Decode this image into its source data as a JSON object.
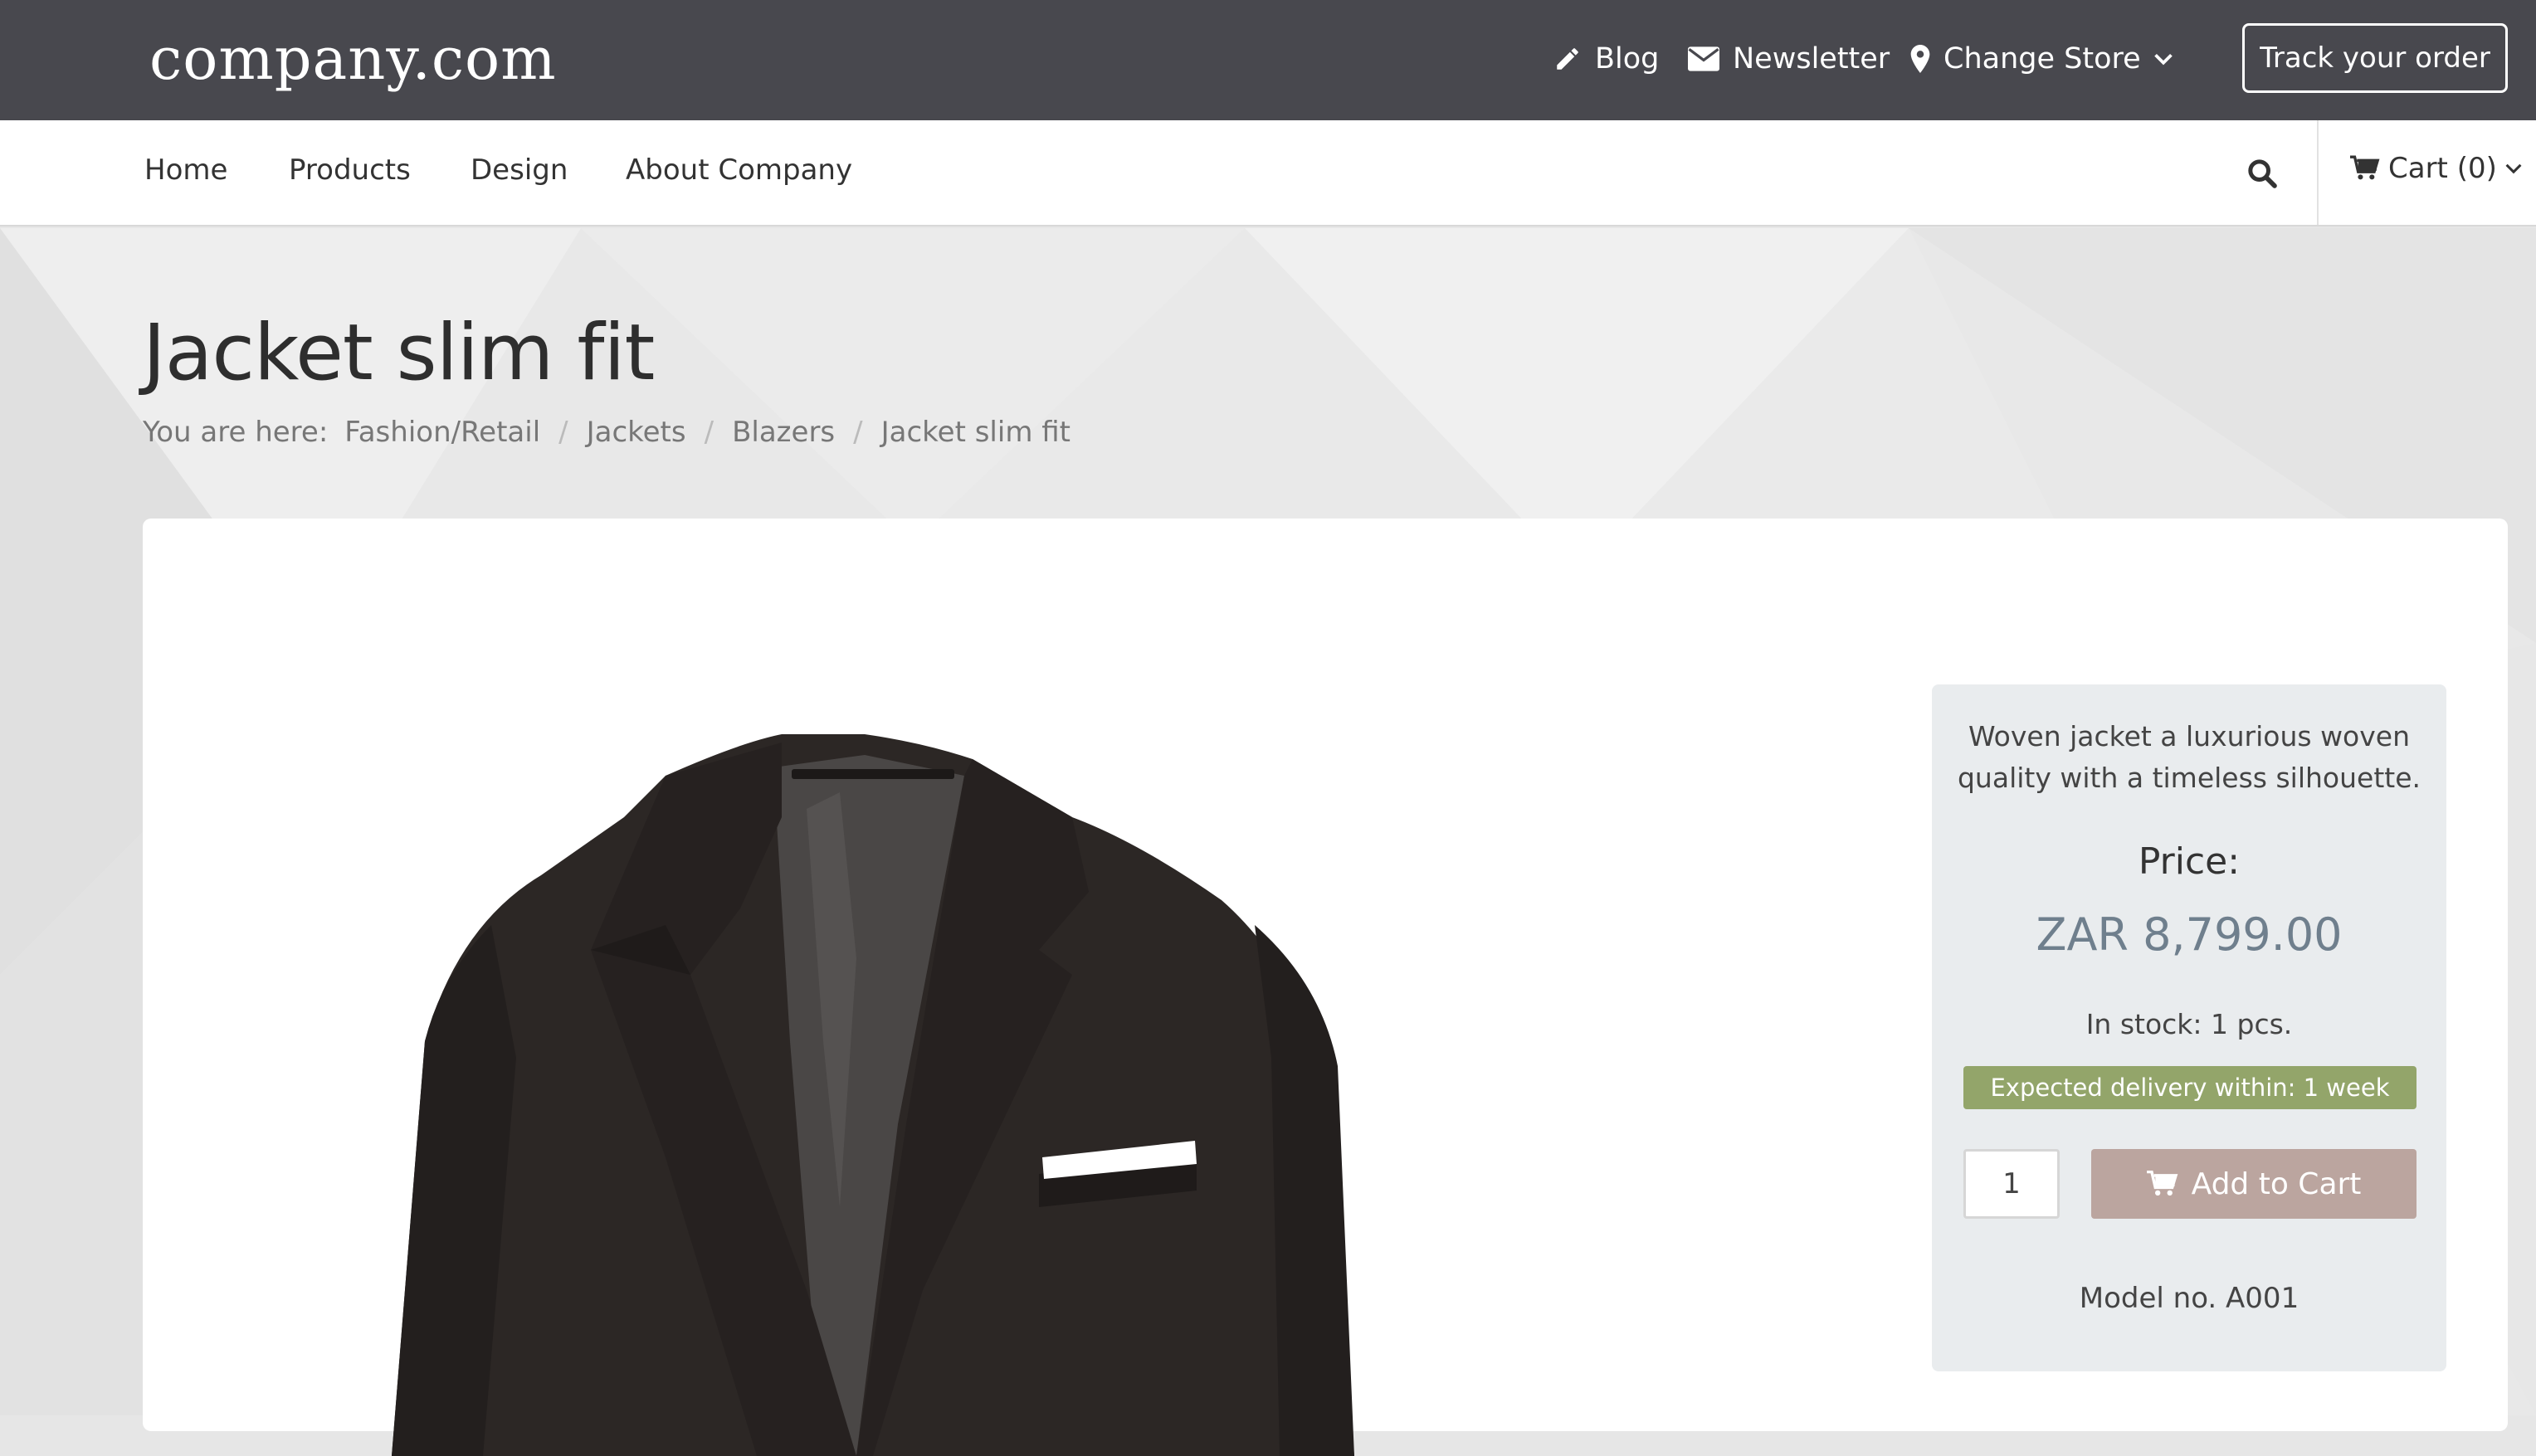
{
  "header": {
    "logo": "company.com",
    "links": [
      {
        "label": "Blog",
        "icon": "pencil-icon"
      },
      {
        "label": "Newsletter",
        "icon": "envelope-icon"
      },
      {
        "label": "Change Store",
        "icon": "map-marker-icon"
      }
    ],
    "track_order_label": "Track your order"
  },
  "nav": {
    "items": [
      "Home",
      "Products",
      "Design",
      "About Company"
    ],
    "cart_label": "Cart (0)"
  },
  "page": {
    "title": "Jacket slim fit",
    "breadcrumb_lead": "You are here:",
    "breadcrumb": [
      "Fashion/Retail",
      "Jackets",
      "Blazers",
      "Jacket slim fit"
    ]
  },
  "product": {
    "description": "Woven jacket a luxurious woven quality with a timeless silhouette.",
    "price_label": "Price:",
    "price": "ZAR 8,799.00",
    "stock": "In stock: 1 pcs.",
    "delivery": "Expected delivery within: 1 week",
    "quantity": "1",
    "add_to_cart_label": "Add to Cart",
    "model": "Model no. A001"
  },
  "colors": {
    "topbar": "#48484e",
    "delivery_badge": "#93a56a",
    "add_to_cart": "#bba59f",
    "price": "#6f7f8d"
  }
}
